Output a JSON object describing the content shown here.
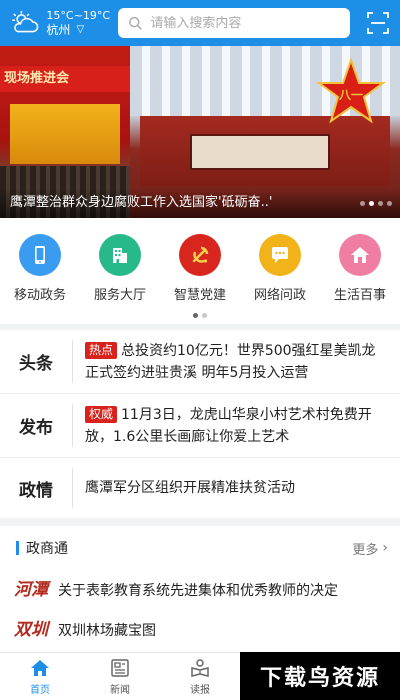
{
  "header": {
    "weather": {
      "temp": "15°C~19°C",
      "city": "杭州",
      "icon": "partly-cloudy-icon"
    },
    "search_placeholder": "请输入搜索内容",
    "scan_icon": "scan-icon"
  },
  "banner": {
    "sign_text": "现场推进会",
    "caption": "鹰潭整治群众身边腐败工作入选国家'砥砺奋..'",
    "slides": 4,
    "active_slide": 1
  },
  "quick_menu": {
    "items": [
      {
        "label": "移动政务",
        "icon": "mobile-icon",
        "color": "#3a9cf0"
      },
      {
        "label": "服务大厅",
        "icon": "building-icon",
        "color": "#27b98a"
      },
      {
        "label": "智慧党建",
        "icon": "party-emblem-icon",
        "color": "#d8261e"
      },
      {
        "label": "网络问政",
        "icon": "chat-icon",
        "color": "#f2b21a"
      },
      {
        "label": "生活百事",
        "icon": "home-icon",
        "color": "#f07ea2"
      }
    ]
  },
  "news": {
    "rows": [
      {
        "category": "头条",
        "tag": "热点",
        "text": "总投资约10亿元！世界500强红星美凯龙正式签约进驻贵溪 明年5月投入运营"
      },
      {
        "category": "发布",
        "tag": "权威",
        "text": "11月3日，龙虎山华泉小村艺术村免费开放，1.6公里长画廊让你爱上艺术"
      },
      {
        "category": "政情",
        "tag": "",
        "text": "鹰潭军分区组织开展精准扶贫活动"
      }
    ]
  },
  "zst": {
    "title": "政商通",
    "more_label": "更多",
    "articles": [
      {
        "logo": "河潭",
        "title": "关于表彰教育系统先进集体和优秀教师的决定"
      },
      {
        "logo": "双圳",
        "title": "双圳林场藏宝图"
      }
    ]
  },
  "bottom_nav": {
    "tabs": [
      {
        "label": "首页",
        "icon": "home-icon",
        "active": true
      },
      {
        "label": "新闻",
        "icon": "newspaper-icon",
        "active": false
      },
      {
        "label": "读报",
        "icon": "reader-icon",
        "active": false
      }
    ]
  },
  "watermark": {
    "text": "下载鸟资源"
  },
  "colors": {
    "brand_blue": "#1e8fe6",
    "tag_red": "#d8221b"
  }
}
